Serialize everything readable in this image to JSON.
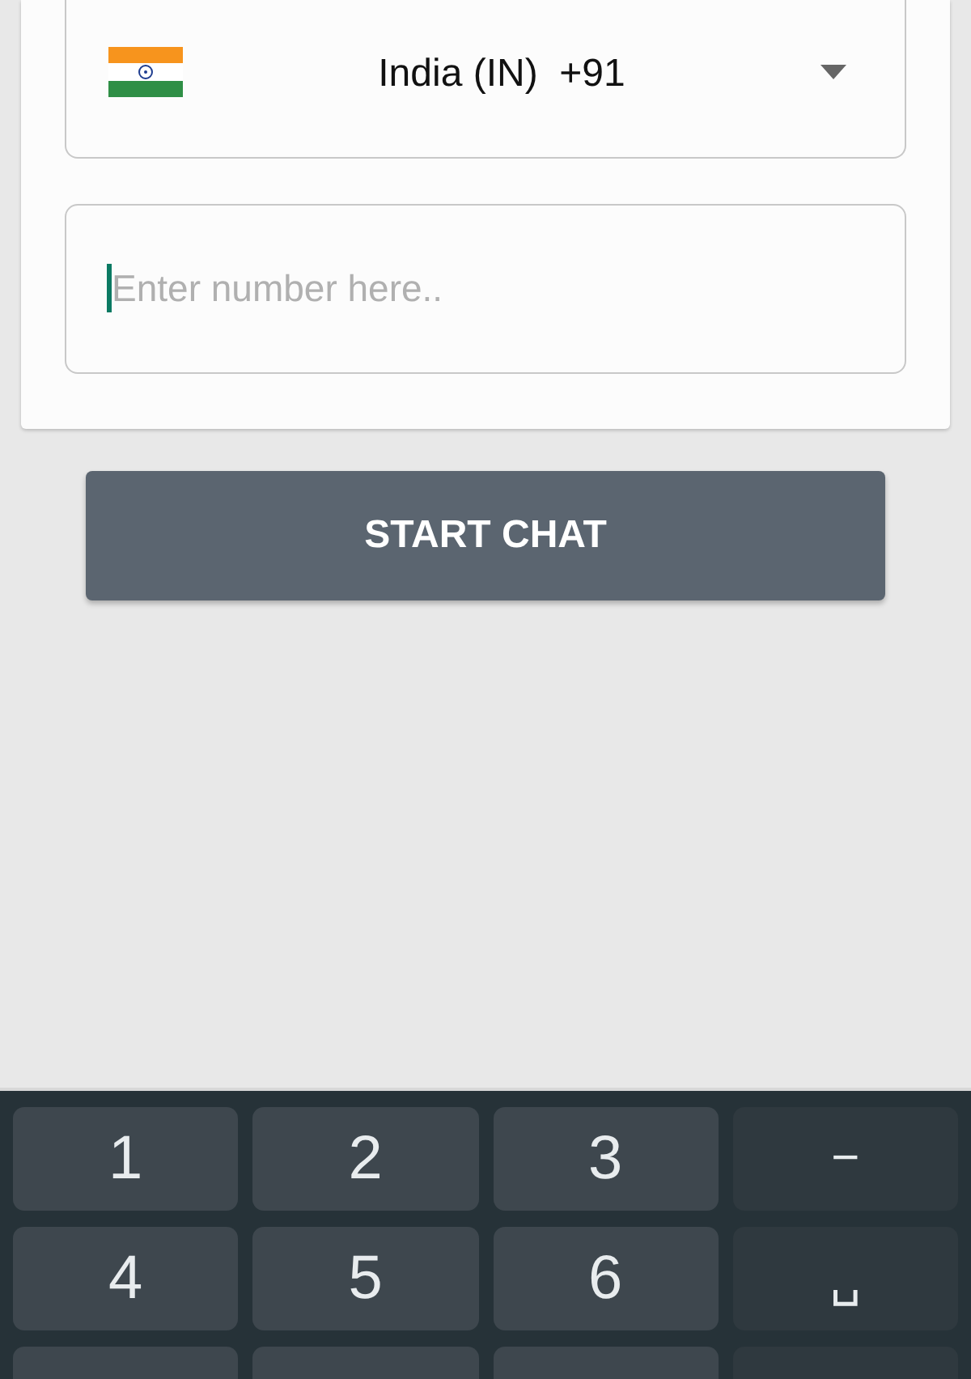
{
  "country_selector": {
    "country": "India (IN)",
    "code": "+91"
  },
  "phone_field": {
    "placeholder": "Enter number here..",
    "focused": true
  },
  "start_button": {
    "label": "START CHAT"
  },
  "keyboard": {
    "rows": [
      [
        {
          "label": "1",
          "kind": "digit"
        },
        {
          "label": "2",
          "kind": "digit"
        },
        {
          "label": "3",
          "kind": "digit"
        },
        {
          "label": "−",
          "kind": "function"
        }
      ],
      [
        {
          "label": "4",
          "kind": "digit"
        },
        {
          "label": "5",
          "kind": "digit"
        },
        {
          "label": "6",
          "kind": "digit"
        },
        {
          "label": "␣",
          "kind": "function"
        }
      ],
      [
        {
          "kind": "digit"
        },
        {
          "kind": "digit"
        },
        {
          "kind": "digit"
        },
        {
          "kind": "function"
        }
      ]
    ]
  }
}
